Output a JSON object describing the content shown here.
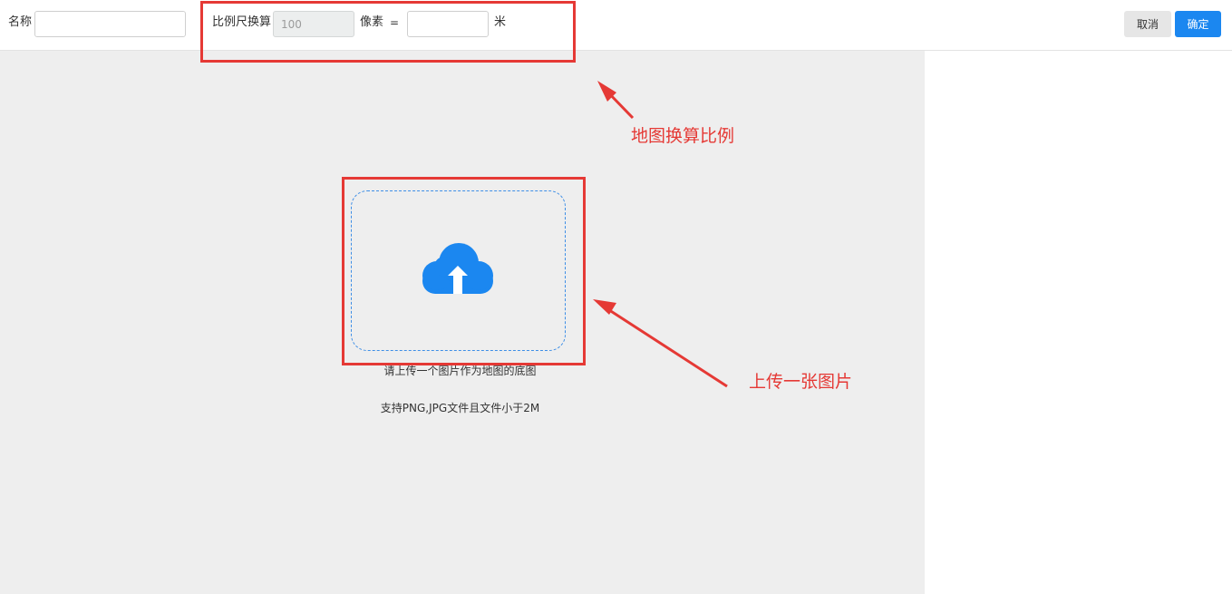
{
  "toolbar": {
    "name_label": "名称",
    "name_value": "",
    "scale_label": "比例尺换算",
    "pixels_value": "100",
    "pixels_unit": "像素",
    "equals": "=",
    "meters_value": "",
    "meters_unit": "米",
    "cancel_label": "取消",
    "confirm_label": "确定"
  },
  "upload": {
    "icon": "cloud-upload-icon",
    "hint_line1": "请上传一个图片作为地图的底图",
    "hint_line2": "支持PNG,JPG文件且文件小于2M"
  },
  "annotations": {
    "scale_note": "地图换算比例",
    "upload_note": "上传一张图片"
  },
  "colors": {
    "primary": "#1b87f0",
    "annotation": "#e53935",
    "canvas_bg": "#eeeeee",
    "upload_border": "#3d8ee6"
  }
}
